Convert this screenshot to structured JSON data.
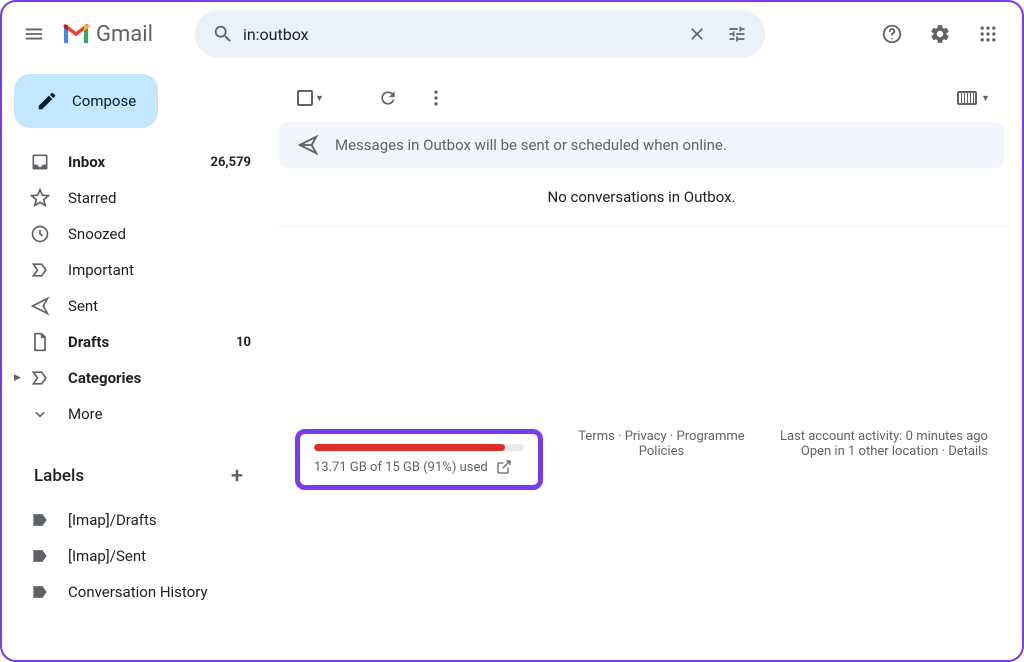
{
  "header": {
    "logo_text": "Gmail",
    "search_value": "in:outbox"
  },
  "compose_label": "Compose",
  "nav": [
    {
      "icon": "inbox",
      "label": "Inbox",
      "count": "26,579",
      "bold": true
    },
    {
      "icon": "star",
      "label": "Starred"
    },
    {
      "icon": "clock",
      "label": "Snoozed"
    },
    {
      "icon": "important",
      "label": "Important"
    },
    {
      "icon": "send",
      "label": "Sent"
    },
    {
      "icon": "file",
      "label": "Drafts",
      "count": "10",
      "bold": true
    },
    {
      "icon": "category",
      "label": "Categories",
      "bold": true,
      "caret": true
    },
    {
      "icon": "chevron-down",
      "label": "More"
    }
  ],
  "labels_header": "Labels",
  "labels": [
    {
      "label": "[Imap]/Drafts"
    },
    {
      "label": "[Imap]/Sent"
    },
    {
      "label": "Conversation History"
    }
  ],
  "banner_text": "Messages in Outbox will be sent or scheduled when online.",
  "empty_text": "No conversations in Outbox.",
  "footer": {
    "storage_text": "13.71 GB of 15 GB (91%) used",
    "storage_percent": 91,
    "terms": "Terms",
    "privacy": "Privacy",
    "policies": "Programme Policies",
    "activity_line": "Last account activity: 0 minutes ago",
    "open_line": "Open in 1 other location",
    "details": "Details"
  }
}
